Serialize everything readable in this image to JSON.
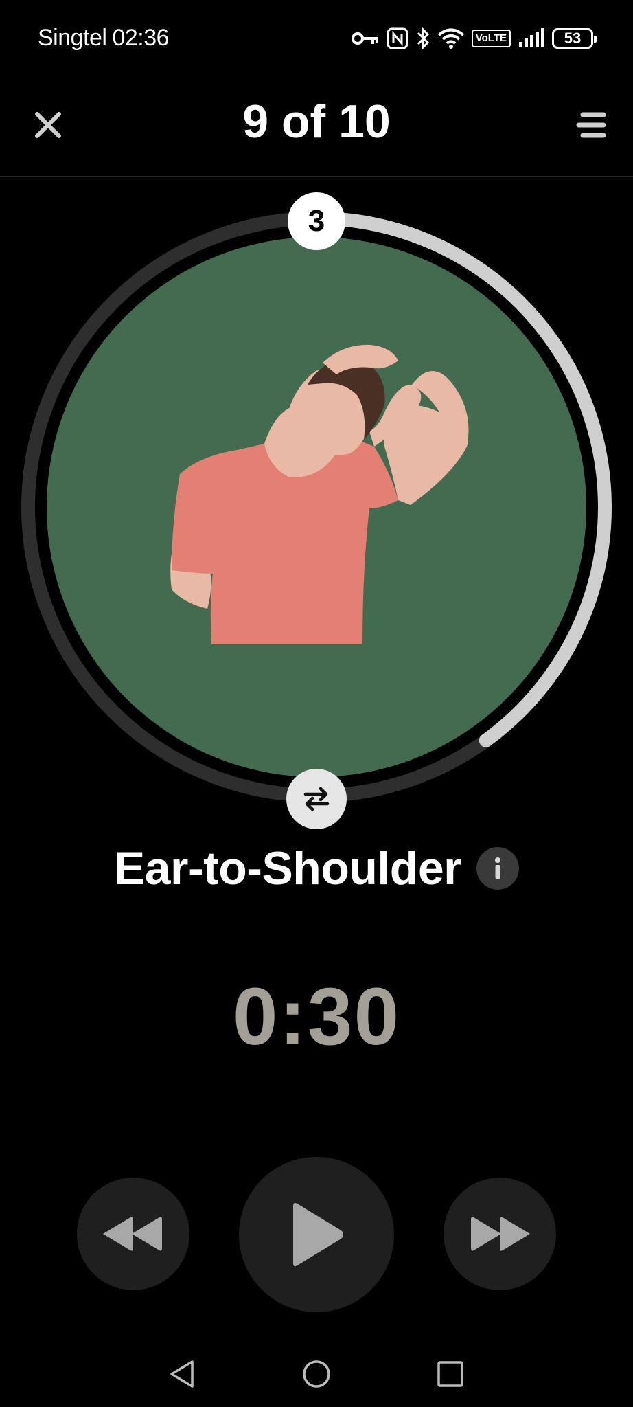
{
  "status_bar": {
    "carrier": "Singtel",
    "time": "02:36",
    "volte": "VoLTE",
    "battery": "53",
    "icons": [
      "key-icon",
      "nfc-icon",
      "bluetooth-icon",
      "wifi-icon",
      "volte-icon",
      "signal-icon",
      "battery-icon"
    ]
  },
  "header": {
    "title": "9 of 10",
    "close_icon": "close-icon",
    "menu_icon": "menu-icon"
  },
  "progress_ring": {
    "step_count": "3",
    "progress_fraction": 0.4,
    "track_color": "#2e2e2e",
    "progress_color": "#cfcfcf",
    "image_bg_color": "#436b50"
  },
  "exercise": {
    "name": "Ear-to-Shoulder",
    "info_icon": "info-icon",
    "swap_icon": "swap-sides-icon"
  },
  "timer": {
    "value": "0:30"
  },
  "controls": {
    "rewind_icon": "rewind-icon",
    "play_icon": "play-icon",
    "forward_icon": "fast-forward-icon"
  },
  "nav_bar": {
    "back_icon": "nav-back-icon",
    "home_icon": "nav-home-icon",
    "recents_icon": "nav-recents-icon"
  }
}
